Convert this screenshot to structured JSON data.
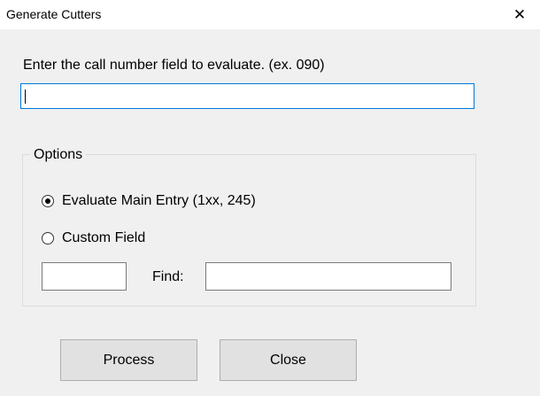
{
  "window": {
    "title": "Generate Cutters",
    "close_glyph": "✕"
  },
  "main": {
    "prompt_label": "Enter the call number field to evaluate. (ex. 090)",
    "call_number_value": "",
    "options": {
      "legend": "Options",
      "radio_main_entry_label": "Evaluate Main Entry (1xx, 245)",
      "radio_main_entry_checked": true,
      "radio_custom_label": "Custom Field",
      "radio_custom_checked": false,
      "custom_field_value": "",
      "find_label": "Find:",
      "find_value": ""
    }
  },
  "buttons": {
    "process_label": "Process",
    "close_label": "Close"
  },
  "colors": {
    "focus_border": "#0078d7",
    "window_bg": "#f0f0f0",
    "button_bg": "#e1e1e1"
  }
}
